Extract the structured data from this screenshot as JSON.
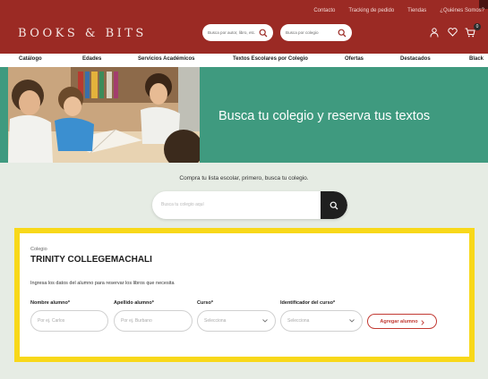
{
  "top_links": [
    "Contacto",
    "Tracking de pedido",
    "Tiendas",
    "¿Quiénes Somos?"
  ],
  "brand": {
    "logo_text": "BOOKS & BITS"
  },
  "header_search": {
    "books_placeholder": "Busca por autor, libro, etc.",
    "school_placeholder": "Busca por colegio"
  },
  "header_icons": [
    "user-icon",
    "heart-icon",
    "cart-icon"
  ],
  "cart_count": "0",
  "nav": [
    "Catálogo",
    "Edades",
    "Servicios Académicos",
    "Textos Escolares por Colegio",
    "Ofertas",
    "Destacados",
    "Black"
  ],
  "hero": {
    "title": "Busca tu colegio y reserva tus textos"
  },
  "school_search": {
    "intro": "Compra tu lista escolar, primero, busca tu colegio.",
    "placeholder": "Busca tu colegio aquí"
  },
  "form": {
    "colegio_label": "Colegio",
    "colegio_name": "TRINITY COLLEGEMACHALI",
    "instructions": "Ingresa los datos del alumno para reservar los libros que necesita",
    "fields": [
      {
        "label": "Nombre alumno*",
        "placeholder": "Por ej. Carlos"
      },
      {
        "label": "Apellido alumno*",
        "placeholder": "Por ej. Burbano"
      },
      {
        "label": "Curso*",
        "placeholder": "Selecciona"
      },
      {
        "label": "Identificador del curso*",
        "placeholder": "Selecciona"
      }
    ],
    "add_button": "Agregar alumno"
  },
  "colors": {
    "header_red": "#9b2a24",
    "hero_green": "#3f9a7f",
    "highlight_yellow": "#f8d81a",
    "accent_red": "#c23a33"
  }
}
